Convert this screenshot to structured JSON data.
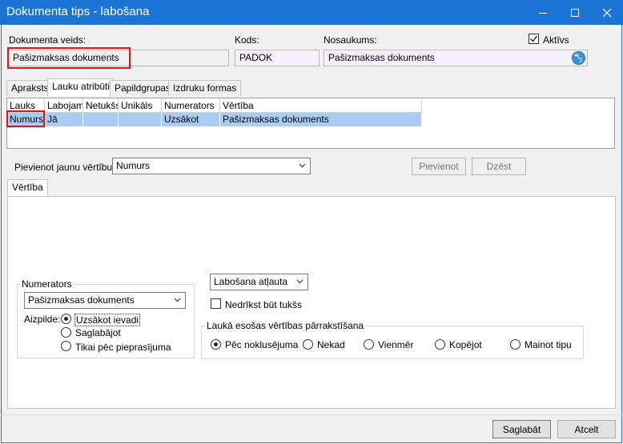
{
  "window": {
    "title": "Dokumenta tips - labošana",
    "minimize_icon": "minimize-icon",
    "maximize_icon": "maximize-icon",
    "close_icon": "close-icon"
  },
  "header": {
    "doc_type_label": "Dokumenta veids:",
    "doc_type_value": "Pašizmaksas dokuments",
    "code_label": "Kods:",
    "code_value": "PADOK",
    "name_label": "Nosaukums:",
    "name_value": "Pašizmaksas dokuments",
    "active_label": "Aktīvs",
    "active_checked": true,
    "globe_icon": "globe-icon"
  },
  "tabs": [
    {
      "label": "Apraksts"
    },
    {
      "label": "Lauku atribūti",
      "active": true
    },
    {
      "label": "Papildgrupas"
    },
    {
      "label": "Izdruku formas"
    }
  ],
  "grid": {
    "columns": [
      "Lauks",
      "Labojams",
      "Netukšs",
      "Unikāls",
      "Numerators",
      "Vērtība"
    ],
    "rows": [
      [
        "Numurs",
        "Jā",
        "",
        "",
        "Uzsākot",
        "Pašizmaksas dokuments"
      ]
    ]
  },
  "add_value": {
    "label": "Pievienot jaunu vērtību:",
    "selected": "Numurs",
    "add_button": "Pievienot",
    "delete_button": "Dzēst"
  },
  "value_tab": {
    "label": "Vērtība"
  },
  "numerator": {
    "group_title": "Numerators",
    "selected": "Pašizmaksas dokuments",
    "assign_label": "Aizpilde:",
    "options": [
      "Uzsākot ievadi",
      "Saglabājot",
      "Tikai pēc pieprasījuma"
    ],
    "selected_index": 0
  },
  "edit": {
    "selected": "Labošana atļauta",
    "not_empty_label": "Nedrīkst būt tukšs",
    "not_empty_checked": false
  },
  "overwrite": {
    "group_title": "Laukā esošas vērtības pārrakstīšana",
    "options": [
      "Pēc noklusējuma",
      "Nekad",
      "Vienmēr",
      "Kopējot",
      "Mainot tipu"
    ],
    "selected_index": 0
  },
  "footer": {
    "save_button": "Saglabāt",
    "cancel_button": "Atcelt"
  },
  "colors": {
    "titlebar": "#1b73d4",
    "selection": "#a9cdf2",
    "highlight_box": "#e11414"
  }
}
